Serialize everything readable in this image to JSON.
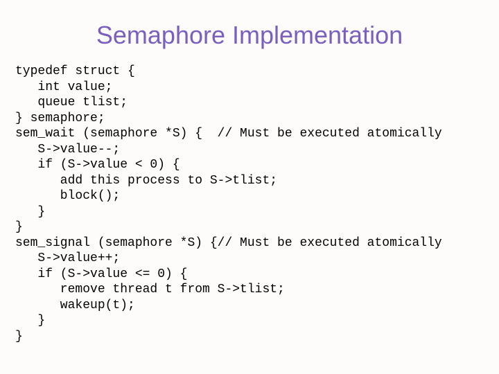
{
  "title": "Semaphore Implementation",
  "code": "typedef struct {\n   int value;\n   queue tlist;\n} semaphore;\nsem_wait (semaphore *S) {  // Must be executed atomically\n   S->value--;\n   if (S->value < 0) {\n      add this process to S->tlist;\n      block();\n   }\n}\nsem_signal (semaphore *S) {// Must be executed atomically\n   S->value++;\n   if (S->value <= 0) {\n      remove thread t from S->tlist;\n      wakeup(t);\n   }\n}"
}
